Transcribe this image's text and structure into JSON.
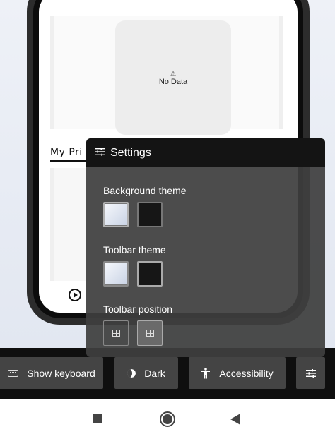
{
  "app_screen": {
    "no_data_icon": "⚠",
    "no_data_text": "No Data",
    "section_title": "My Pri"
  },
  "settings": {
    "title": "Settings",
    "icon": "sliders-icon",
    "background_theme": {
      "label": "Background theme",
      "options": [
        "light",
        "dark"
      ],
      "selected": "light"
    },
    "toolbar_theme": {
      "label": "Toolbar theme",
      "options": [
        "light",
        "dark"
      ],
      "selected": "dark"
    },
    "toolbar_position": {
      "label": "Toolbar position",
      "options": [
        "top",
        "bottom"
      ],
      "selected": "bottom"
    }
  },
  "toolbar": {
    "keyboard_label": "Show keyboard",
    "dark_label": "Dark",
    "accessibility_label": "Accessibility",
    "settings_icon": "sliders-icon"
  },
  "colors": {
    "toolbar_bg": "#0f0f0f",
    "button_bg": "#444444",
    "panel_bg": "#3e3e3e",
    "panel_header_bg": "#141414"
  },
  "navbar": {
    "recents": "square-icon",
    "home": "circle-icon",
    "back": "triangle-back-icon"
  }
}
